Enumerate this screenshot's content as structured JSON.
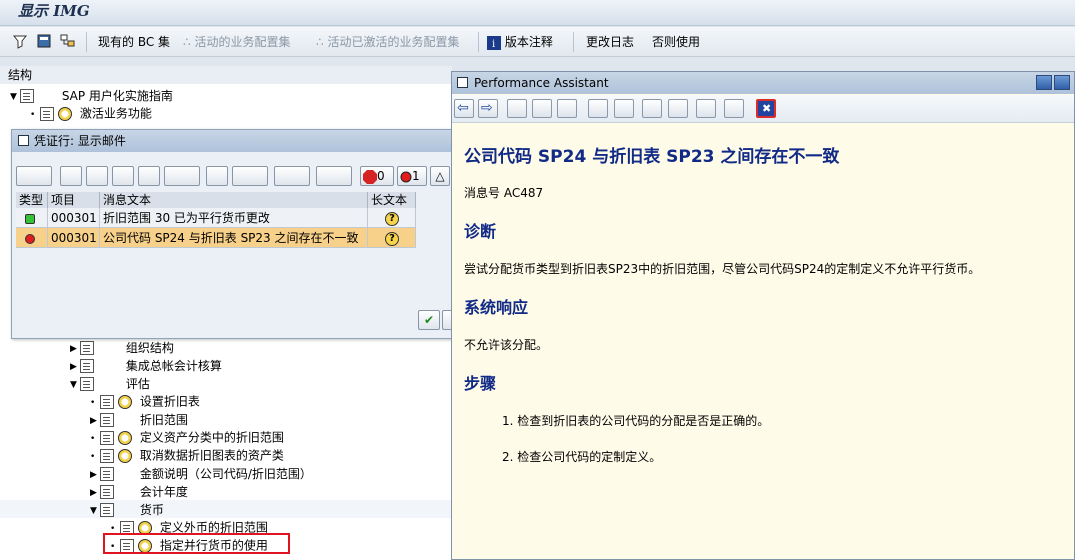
{
  "window": {
    "title": "显示 IMG"
  },
  "toolbar": {
    "bc_set": "现有的 BC 集",
    "active_set": "活动的业务配置集",
    "active_activated_set": "活动已激活的业务配置集",
    "release_notes": "版本注释",
    "change_log": "更改日志",
    "usage": "否则使用"
  },
  "tree": {
    "header": "结构",
    "items": [
      {
        "label": "SAP 用户化实施指南"
      },
      {
        "label": "激活业务功能"
      },
      {
        "label": "组织结构"
      },
      {
        "label": "集成总帐会计核算"
      },
      {
        "label": "评估"
      },
      {
        "label": "设置折旧表"
      },
      {
        "label": "折旧范围"
      },
      {
        "label": "定义资产分类中的折旧范围"
      },
      {
        "label": "取消数据折旧图表的资产类"
      },
      {
        "label": "金额说明（公司代码/折旧范围）"
      },
      {
        "label": "会计年度"
      },
      {
        "label": "货币"
      },
      {
        "label": "定义外币的折旧范围"
      },
      {
        "label": "指定并行货币的使用"
      }
    ]
  },
  "popup": {
    "title": "凭证行: 显示邮件",
    "stop_count": "0",
    "error_count": "1",
    "columns": [
      "类型",
      "项目",
      "消息文本",
      "长文本"
    ],
    "rows": [
      {
        "item": "000301",
        "text": "折旧范围 30 已为平行货币更改",
        "status": "green"
      },
      {
        "item": "000301",
        "text": "公司代码 SP24 与折旧表 SP23 之间存在不一致",
        "status": "red"
      }
    ]
  },
  "assistant": {
    "title": "Performance Assistant",
    "heading": "公司代码  SP24 与折旧表  SP23 之间存在不一致",
    "msg_no": "消息号  AC487",
    "diag_title": "诊断",
    "diag_text": "尝试分配货币类型到折旧表SP23中的折旧范围，尽管公司代码SP24的定制定义不允许平行货币。",
    "resp_title": "系统响应",
    "resp_text": "不允许该分配。",
    "steps_title": "步骤",
    "step1": "1. 检查到折旧表的公司代码的分配是否是正确的。",
    "step2": "2. 检查公司代码的定制定义。"
  },
  "colors": {
    "accent": "#102a86",
    "highlight": "#e0141e",
    "selected_row": "#f7d08a"
  }
}
